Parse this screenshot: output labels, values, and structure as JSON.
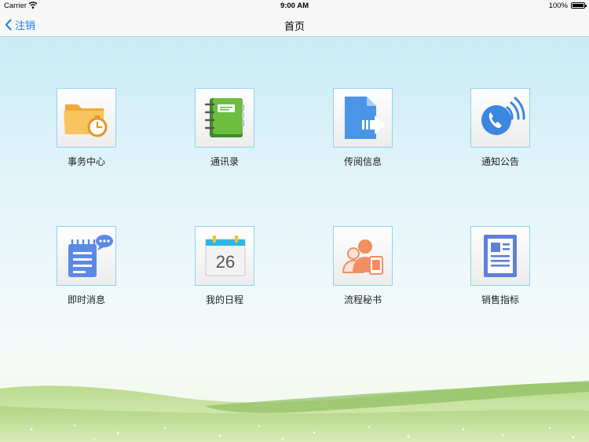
{
  "status_bar": {
    "carrier": "Carrier",
    "time": "9:00 AM",
    "battery": "100%"
  },
  "nav": {
    "back_label": "注销",
    "title": "首页"
  },
  "tiles": [
    {
      "label": "事务中心",
      "icon": "folder-clock-icon"
    },
    {
      "label": "通讯录",
      "icon": "address-book-icon"
    },
    {
      "label": "传阅信息",
      "icon": "document-forward-icon"
    },
    {
      "label": "通知公告",
      "icon": "phone-call-icon"
    },
    {
      "label": "即时消息",
      "icon": "notepad-chat-icon"
    },
    {
      "label": "我的日程",
      "icon": "calendar-icon"
    },
    {
      "label": "流程秘书",
      "icon": "people-device-icon"
    },
    {
      "label": "销售指标",
      "icon": "report-icon"
    }
  ],
  "calendar_day": "26",
  "colors": {
    "accent": "#1a7ef7",
    "tile_border": "#8fd2ee"
  }
}
